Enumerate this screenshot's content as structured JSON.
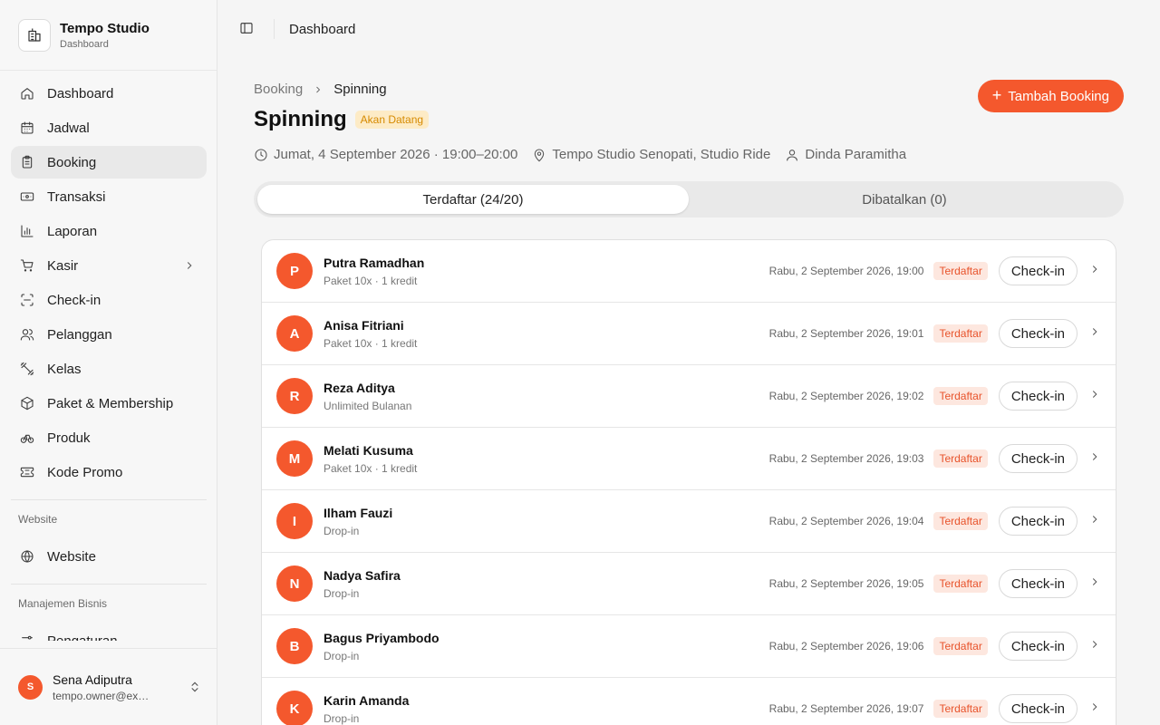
{
  "brand": {
    "title": "Tempo Studio",
    "subtitle": "Dashboard"
  },
  "sidebar": {
    "items": [
      {
        "label": "Dashboard",
        "icon": "home-icon"
      },
      {
        "label": "Jadwal",
        "icon": "calendar-icon"
      },
      {
        "label": "Booking",
        "icon": "clipboard-icon",
        "active": true
      },
      {
        "label": "Transaksi",
        "icon": "banknote-icon"
      },
      {
        "label": "Laporan",
        "icon": "bar-chart-icon"
      },
      {
        "label": "Kasir",
        "icon": "cart-icon",
        "has_submenu": true
      },
      {
        "label": "Check-in",
        "icon": "scan-icon"
      },
      {
        "label": "Pelanggan",
        "icon": "users-icon"
      },
      {
        "label": "Kelas",
        "icon": "dumbbell-icon"
      },
      {
        "label": "Paket & Membership",
        "icon": "package-icon"
      },
      {
        "label": "Produk",
        "icon": "bike-icon"
      },
      {
        "label": "Kode Promo",
        "icon": "ticket-icon"
      }
    ],
    "section_website": "Website",
    "website_item": {
      "label": "Website",
      "icon": "globe-icon"
    },
    "section_business": "Manajemen Bisnis",
    "business_item": {
      "label": "Pengaturan",
      "icon": "settings-icon"
    }
  },
  "user": {
    "initial": "S",
    "name": "Sena Adiputra",
    "email": "tempo.owner@example.com"
  },
  "topbar": {
    "title": "Dashboard"
  },
  "breadcrumb": {
    "parent": "Booking",
    "current": "Spinning"
  },
  "page": {
    "title": "Spinning",
    "status": "Akan Datang",
    "datetime": "Jumat, 4 September 2026 · 19:00–20:00",
    "location": "Tempo Studio Senopati, Studio Ride",
    "instructor": "Dinda Paramitha",
    "add_button": "Tambah Booking"
  },
  "tabs": [
    {
      "label": "Terdaftar (24/20)",
      "active": true
    },
    {
      "label": "Dibatalkan (0)",
      "active": false
    }
  ],
  "bookings": [
    {
      "initial": "P",
      "name": "Putra Ramadhan",
      "package": "Paket 10x · 1 kredit",
      "date": "Rabu, 2 September 2026, 19:00",
      "status": "Terdaftar",
      "action": "Check-in"
    },
    {
      "initial": "A",
      "name": "Anisa Fitriani",
      "package": "Paket 10x · 1 kredit",
      "date": "Rabu, 2 September 2026, 19:01",
      "status": "Terdaftar",
      "action": "Check-in"
    },
    {
      "initial": "R",
      "name": "Reza Aditya",
      "package": "Unlimited Bulanan",
      "date": "Rabu, 2 September 2026, 19:02",
      "status": "Terdaftar",
      "action": "Check-in"
    },
    {
      "initial": "M",
      "name": "Melati Kusuma",
      "package": "Paket 10x · 1 kredit",
      "date": "Rabu, 2 September 2026, 19:03",
      "status": "Terdaftar",
      "action": "Check-in"
    },
    {
      "initial": "I",
      "name": "Ilham Fauzi",
      "package": "Drop-in",
      "date": "Rabu, 2 September 2026, 19:04",
      "status": "Terdaftar",
      "action": "Check-in"
    },
    {
      "initial": "N",
      "name": "Nadya Safira",
      "package": "Drop-in",
      "date": "Rabu, 2 September 2026, 19:05",
      "status": "Terdaftar",
      "action": "Check-in"
    },
    {
      "initial": "B",
      "name": "Bagus Priyambodo",
      "package": "Drop-in",
      "date": "Rabu, 2 September 2026, 19:06",
      "status": "Terdaftar",
      "action": "Check-in"
    },
    {
      "initial": "K",
      "name": "Karin Amanda",
      "package": "Drop-in",
      "date": "Rabu, 2 September 2026, 19:07",
      "status": "Terdaftar",
      "action": "Check-in"
    }
  ],
  "colors": {
    "accent": "#f4582d",
    "status_upcoming_bg": "#fdebc6",
    "status_upcoming_text": "#d68a00",
    "badge_bg": "#fde7df",
    "badge_text": "#e8532b"
  }
}
